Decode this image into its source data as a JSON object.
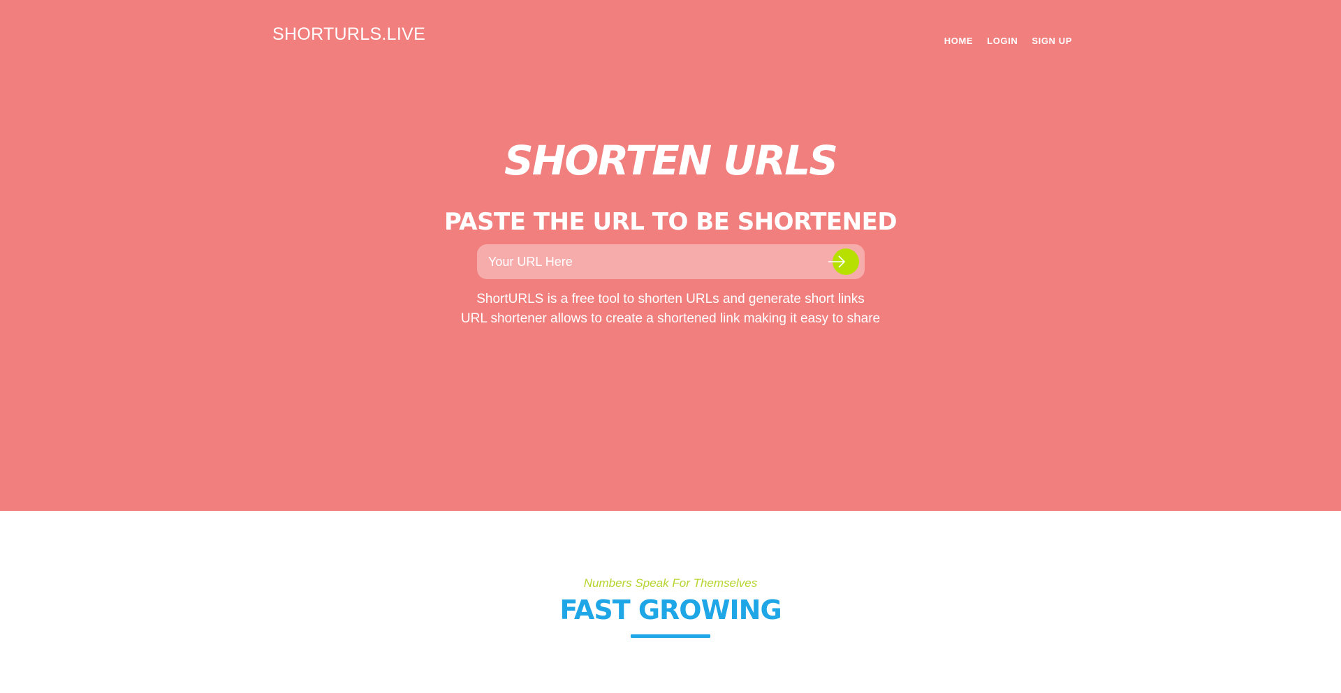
{
  "header": {
    "brand": "SHORTURLS.LIVE",
    "nav": [
      {
        "label": "HOME"
      },
      {
        "label": "LOGIN"
      },
      {
        "label": "SIGN UP"
      }
    ]
  },
  "hero": {
    "title": "SHORTEN URLS",
    "subtitle": "PASTE THE URL TO BE SHORTENED",
    "input": {
      "placeholder": "Your URL Here",
      "value": ""
    },
    "submit_icon": "arrow-right-icon",
    "description": [
      "ShortURLS is a free tool to shorten URLs and generate short links",
      "URL shortener allows to create a shortened link making it easy to share"
    ]
  },
  "stats": {
    "tagline": "Numbers Speak For Themselves",
    "title": "FAST GROWING"
  },
  "colors": {
    "hero_background": "#f07f7e",
    "input_background": "#f6acab",
    "submit_button": "#b7e000",
    "tagline": "#b6d42d",
    "stats_title": "#1fa6e6"
  }
}
